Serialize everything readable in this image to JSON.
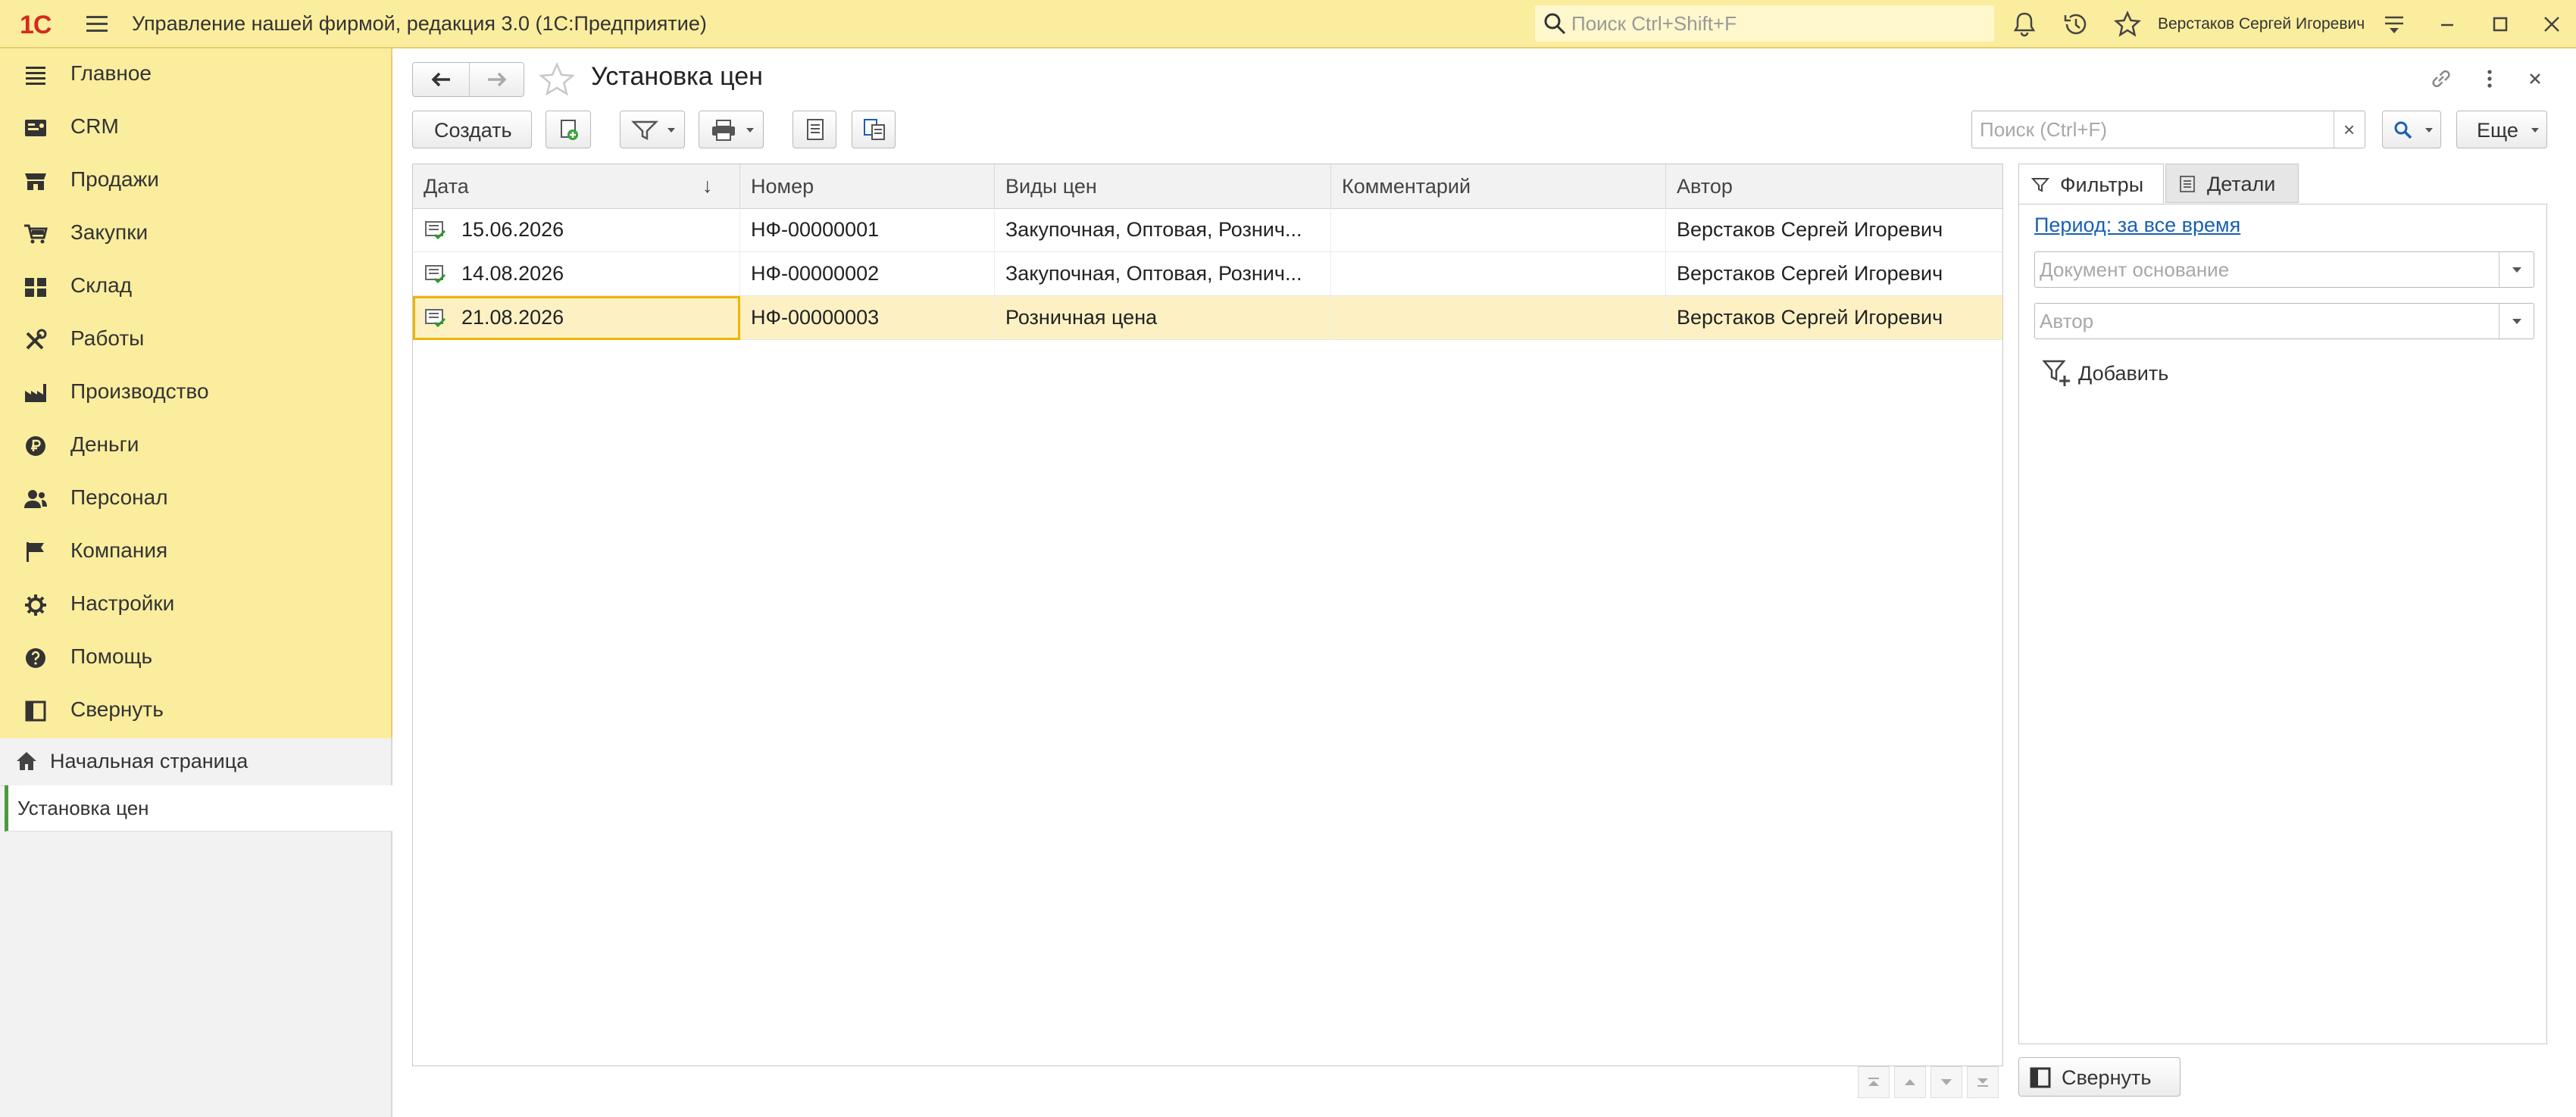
{
  "app": {
    "logo": "1С",
    "title": "Управление нашей фирмой, редакция 3.0  (1С:Предприятие)",
    "search_placeholder": "Поиск Ctrl+Shift+F",
    "user_name": "Верстаков Сергей Игоревич"
  },
  "sidebar": {
    "items": [
      {
        "label": "Главное",
        "icon": "list-icon"
      },
      {
        "label": "CRM",
        "icon": "crm-icon"
      },
      {
        "label": "Продажи",
        "icon": "shop-icon"
      },
      {
        "label": "Закупки",
        "icon": "cart-icon"
      },
      {
        "label": "Склад",
        "icon": "warehouse-icon"
      },
      {
        "label": "Работы",
        "icon": "tools-icon"
      },
      {
        "label": "Производство",
        "icon": "factory-icon"
      },
      {
        "label": "Деньги",
        "icon": "ruble-icon"
      },
      {
        "label": "Персонал",
        "icon": "people-icon"
      },
      {
        "label": "Компания",
        "icon": "flag-icon"
      },
      {
        "label": "Настройки",
        "icon": "gear-icon"
      },
      {
        "label": "Помощь",
        "icon": "help-icon"
      },
      {
        "label": "Свернуть",
        "icon": "collapse-icon"
      }
    ]
  },
  "open_windows": {
    "home": "Начальная страница",
    "current": "Установка цен"
  },
  "page": {
    "title": "Установка цен",
    "create_button": "Создать",
    "search_placeholder": "Поиск (Ctrl+F)",
    "search_clear": "×",
    "more_button": "Еще"
  },
  "table": {
    "columns": [
      "Дата",
      "Номер",
      "Виды цен",
      "Комментарий",
      "Автор"
    ],
    "sort_indicator": "↓",
    "rows": [
      {
        "date": "15.06.2026",
        "number": "НФ-00000001",
        "price_types": "Закупочная, Оптовая, Рознич...",
        "comment": "",
        "author": "Верстаков Сергей Игоревич",
        "selected": false
      },
      {
        "date": "14.08.2026",
        "number": "НФ-00000002",
        "price_types": "Закупочная, Оптовая, Рознич...",
        "comment": "",
        "author": "Верстаков Сергей Игоревич",
        "selected": false
      },
      {
        "date": "21.08.2026",
        "number": "НФ-00000003",
        "price_types": "Розничная цена",
        "comment": "",
        "author": "Верстаков Сергей Игоревич",
        "selected": true
      }
    ]
  },
  "filters": {
    "tab_filters": "Фильтры",
    "tab_details": "Детали",
    "period_link": "Период: за все время",
    "basis_placeholder": "Документ основание",
    "author_placeholder": "Автор",
    "add_label": "Добавить",
    "collapse_label": "Свернуть"
  },
  "colors": {
    "sidebar_bg": "#fbed9e",
    "selected_row": "#fdf1c4",
    "selected_cell_border": "#f0b400",
    "link": "#1a5fb4",
    "logo_red": "#d52a1e"
  }
}
